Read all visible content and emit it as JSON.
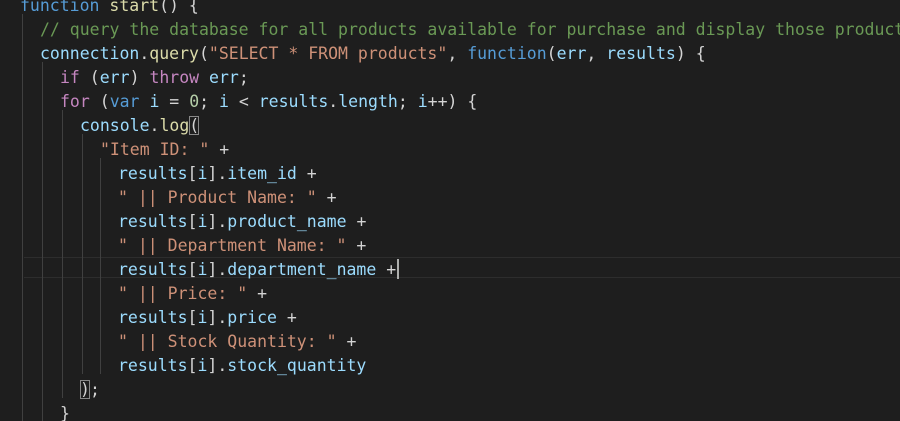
{
  "editor": {
    "language": "javascript",
    "lines": [
      {
        "indent": 20,
        "tokens": [
          {
            "t": "kw",
            "v": "function"
          },
          {
            "t": "pun",
            "v": " "
          },
          {
            "t": "fn",
            "v": "start"
          },
          {
            "t": "pun",
            "v": "() {"
          }
        ]
      },
      {
        "indent": 40,
        "tokens": [
          {
            "t": "cmt",
            "v": "// query the database for all products available for purchase and display those products"
          }
        ]
      },
      {
        "indent": 40,
        "tokens": [
          {
            "t": "var",
            "v": "connection"
          },
          {
            "t": "pun",
            "v": "."
          },
          {
            "t": "fn",
            "v": "query"
          },
          {
            "t": "pun",
            "v": "("
          },
          {
            "t": "str",
            "v": "\"SELECT * FROM products\""
          },
          {
            "t": "pun",
            "v": ", "
          },
          {
            "t": "kw",
            "v": "function"
          },
          {
            "t": "pun",
            "v": "("
          },
          {
            "t": "var",
            "v": "err"
          },
          {
            "t": "pun",
            "v": ", "
          },
          {
            "t": "var",
            "v": "results"
          },
          {
            "t": "pun",
            "v": ") {"
          }
        ]
      },
      {
        "indent": 60,
        "tokens": [
          {
            "t": "ctl",
            "v": "if"
          },
          {
            "t": "pun",
            "v": " ("
          },
          {
            "t": "var",
            "v": "err"
          },
          {
            "t": "pun",
            "v": ") "
          },
          {
            "t": "ctl",
            "v": "throw"
          },
          {
            "t": "pun",
            "v": " "
          },
          {
            "t": "var",
            "v": "err"
          },
          {
            "t": "pun",
            "v": ";"
          }
        ]
      },
      {
        "indent": 60,
        "tokens": [
          {
            "t": "ctl",
            "v": "for"
          },
          {
            "t": "pun",
            "v": " ("
          },
          {
            "t": "kw",
            "v": "var"
          },
          {
            "t": "pun",
            "v": " "
          },
          {
            "t": "var",
            "v": "i"
          },
          {
            "t": "pun",
            "v": " = "
          },
          {
            "t": "num",
            "v": "0"
          },
          {
            "t": "pun",
            "v": "; "
          },
          {
            "t": "var",
            "v": "i"
          },
          {
            "t": "pun",
            "v": " < "
          },
          {
            "t": "var",
            "v": "results"
          },
          {
            "t": "pun",
            "v": "."
          },
          {
            "t": "var",
            "v": "length"
          },
          {
            "t": "pun",
            "v": "; "
          },
          {
            "t": "var",
            "v": "i"
          },
          {
            "t": "pun",
            "v": "++) {"
          }
        ]
      },
      {
        "indent": 80,
        "tokens": [
          {
            "t": "var",
            "v": "console"
          },
          {
            "t": "pun",
            "v": "."
          },
          {
            "t": "fn",
            "v": "log"
          },
          {
            "t": "pun",
            "v": "(",
            "box": true
          }
        ]
      },
      {
        "indent": 100,
        "tokens": [
          {
            "t": "str",
            "v": "\"Item ID: \""
          },
          {
            "t": "pun",
            "v": " +"
          }
        ]
      },
      {
        "indent": 118,
        "tokens": [
          {
            "t": "var",
            "v": "results"
          },
          {
            "t": "pun",
            "v": "["
          },
          {
            "t": "var",
            "v": "i"
          },
          {
            "t": "pun",
            "v": "]."
          },
          {
            "t": "var",
            "v": "item_id"
          },
          {
            "t": "pun",
            "v": " +"
          }
        ]
      },
      {
        "indent": 118,
        "tokens": [
          {
            "t": "str",
            "v": "\" || Product Name: \""
          },
          {
            "t": "pun",
            "v": " +"
          }
        ]
      },
      {
        "indent": 118,
        "tokens": [
          {
            "t": "var",
            "v": "results"
          },
          {
            "t": "pun",
            "v": "["
          },
          {
            "t": "var",
            "v": "i"
          },
          {
            "t": "pun",
            "v": "]."
          },
          {
            "t": "var",
            "v": "product_name"
          },
          {
            "t": "pun",
            "v": " +"
          }
        ]
      },
      {
        "indent": 118,
        "tokens": [
          {
            "t": "str",
            "v": "\" || Department Name: \""
          },
          {
            "t": "pun",
            "v": " +"
          }
        ]
      },
      {
        "indent": 118,
        "cursor": true,
        "tokens": [
          {
            "t": "var",
            "v": "results"
          },
          {
            "t": "pun",
            "v": "["
          },
          {
            "t": "var",
            "v": "i"
          },
          {
            "t": "pun",
            "v": "]."
          },
          {
            "t": "var",
            "v": "department_name"
          },
          {
            "t": "pun",
            "v": " +"
          }
        ]
      },
      {
        "indent": 118,
        "tokens": [
          {
            "t": "str",
            "v": "\" || Price: \""
          },
          {
            "t": "pun",
            "v": " +"
          }
        ]
      },
      {
        "indent": 118,
        "tokens": [
          {
            "t": "var",
            "v": "results"
          },
          {
            "t": "pun",
            "v": "["
          },
          {
            "t": "var",
            "v": "i"
          },
          {
            "t": "pun",
            "v": "]."
          },
          {
            "t": "var",
            "v": "price"
          },
          {
            "t": "pun",
            "v": " +"
          }
        ]
      },
      {
        "indent": 118,
        "tokens": [
          {
            "t": "str",
            "v": "\" || Stock Quantity: \""
          },
          {
            "t": "pun",
            "v": " +"
          }
        ]
      },
      {
        "indent": 118,
        "tokens": [
          {
            "t": "var",
            "v": "results"
          },
          {
            "t": "pun",
            "v": "["
          },
          {
            "t": "var",
            "v": "i"
          },
          {
            "t": "pun",
            "v": "]."
          },
          {
            "t": "var",
            "v": "stock_quantity"
          }
        ]
      },
      {
        "indent": 80,
        "tokens": [
          {
            "t": "pun",
            "v": ")",
            "box": true
          },
          {
            "t": "pun",
            "v": ";"
          }
        ]
      },
      {
        "indent": 60,
        "tokens": [
          {
            "t": "pun",
            "v": "}"
          }
        ]
      }
    ]
  },
  "colors": {
    "background": "#1e1e1e",
    "keyword": "#569cd6",
    "control": "#c586c0",
    "function": "#dcdcaa",
    "variable": "#9cdcfe",
    "string": "#ce9178",
    "number": "#b5cea8",
    "comment": "#6a9955",
    "punctuation": "#d4d4d4"
  }
}
